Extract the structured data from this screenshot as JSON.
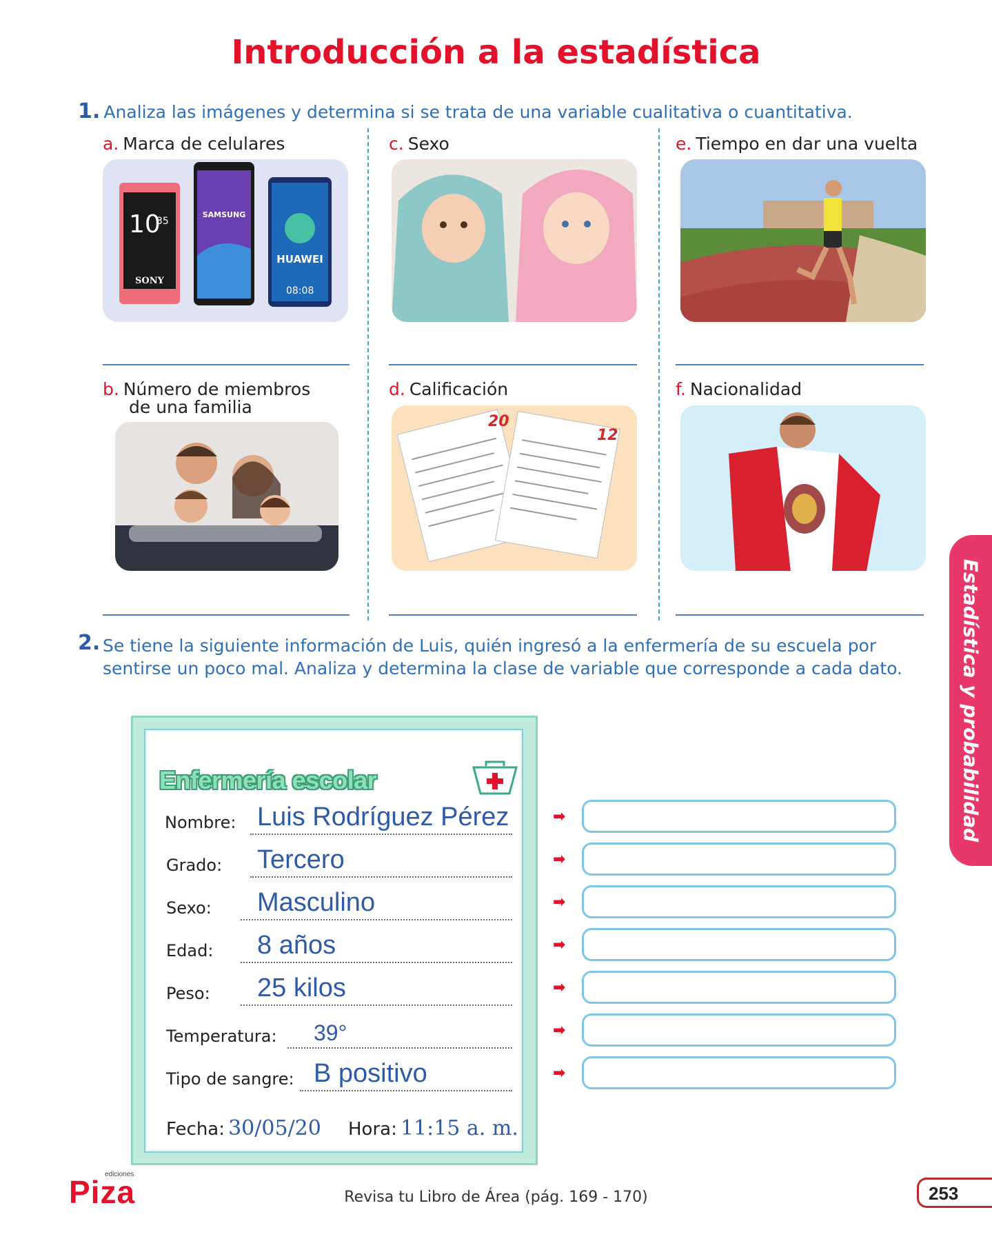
{
  "title": "Introducción a la estadística",
  "side_tab": "Estadística y probabilidad",
  "question1": {
    "number": "1.",
    "text": "Analiza las imágenes y determina si se trata de una variable cualitativa o cuantitativa.",
    "items": [
      {
        "letter": "a.",
        "label": "Marca de celulares",
        "image": "phones"
      },
      {
        "letter": "b.",
        "label_line1": "Número  de  miembros",
        "label_line2": "de una familia",
        "image": "family"
      },
      {
        "letter": "c.",
        "label": "Sexo",
        "image": "babies"
      },
      {
        "letter": "d.",
        "label": "Calificación",
        "image": "exam-papers"
      },
      {
        "letter": "e.",
        "label": "Tiempo en dar una vuelta",
        "image": "runner"
      },
      {
        "letter": "f.",
        "label": "Nacionalidad",
        "image": "peru-flag"
      }
    ],
    "images": {
      "phones": {
        "brands": [
          "SONY",
          "SAMSUNG",
          "HUAWEI"
        ],
        "time1": "10",
        "time1b": "35",
        "time2": "08:08"
      },
      "exams": {
        "grade1": "20",
        "grade2": "12"
      }
    }
  },
  "question2": {
    "number": "2.",
    "text": "Se tiene la siguiente información de Luis, quién ingresó a la enfermería de su escuela por sentirse un poco mal. Analiza y determina la clase de variable que corresponde a cada dato."
  },
  "nurse_card": {
    "title": "Enfermería escolar",
    "fields": [
      {
        "label": "Nombre:",
        "value": "Luis Rodríguez Pérez"
      },
      {
        "label": "Grado:",
        "value": "Tercero"
      },
      {
        "label": "Sexo:",
        "value": "Masculino"
      },
      {
        "label": "Edad:",
        "value": "8 años"
      },
      {
        "label": "Peso:",
        "value": "25 kilos"
      },
      {
        "label": "Temperatura:",
        "value": "39°"
      },
      {
        "label": "Tipo de sangre:",
        "value": "B positivo"
      }
    ],
    "fecha_label": "Fecha:",
    "fecha_value": "30/05/20",
    "hora_label": "Hora:",
    "hora_value": "11:15 a. m."
  },
  "footer": {
    "reference": "Revisa tu Libro de Área (pág. 169 - 170)",
    "page_number": "253",
    "logo": "Piza",
    "logo_small": "ediciones"
  },
  "colors": {
    "accent_red": "#e3122b",
    "accent_blue": "#2e6fb6",
    "tab_pink": "#e8386a",
    "card_green": "#bfeadc"
  }
}
